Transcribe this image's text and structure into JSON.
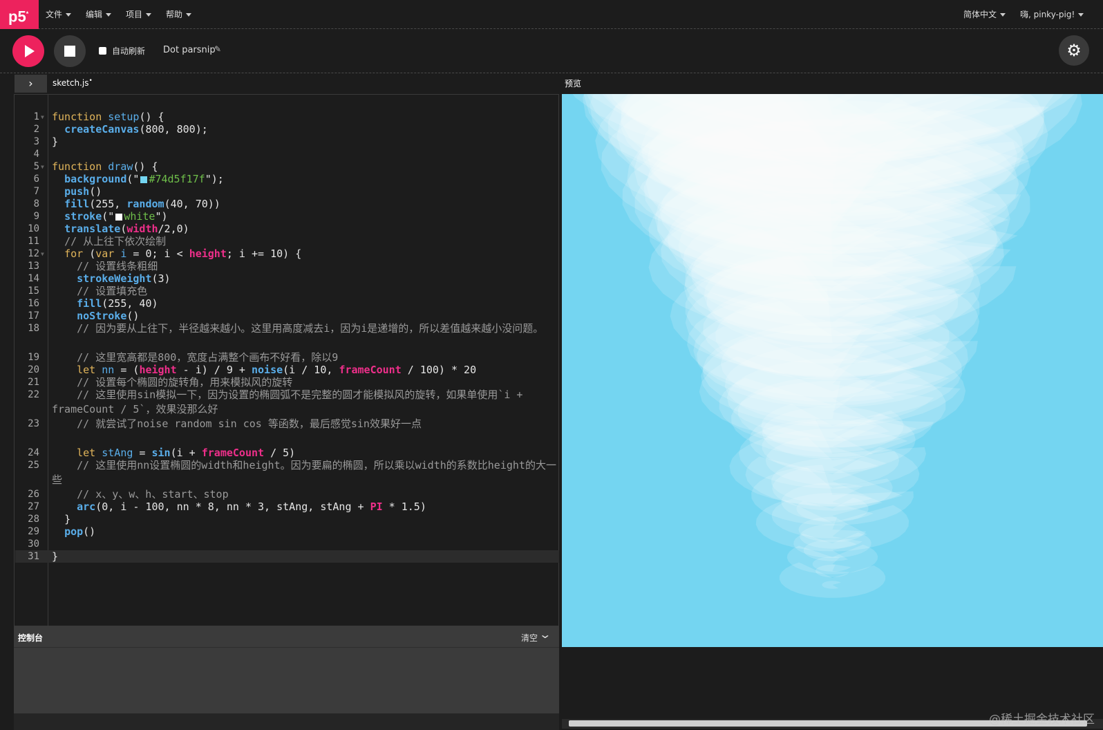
{
  "nav": {
    "logo": "p5",
    "logo_sup": "*",
    "menu": [
      "文件",
      "编辑",
      "项目",
      "帮助"
    ],
    "language": "简体中文",
    "user": "嗨, pinky-pig!"
  },
  "toolbar": {
    "auto_refresh": "自动刷新",
    "auto_refresh_checked": false,
    "project_name": "Dot parsnip"
  },
  "editor": {
    "file_tab": "sketch.js",
    "file_modified_mark": "•",
    "toggle_glyph": "›",
    "active_line": 31,
    "folds": [
      1,
      5,
      12
    ]
  },
  "code_lines": [
    {
      "n": "1",
      "segs": [
        [
          "kw",
          "function "
        ],
        [
          "dc",
          "setup"
        ],
        [
          "nm",
          "() {"
        ]
      ]
    },
    {
      "n": "2",
      "segs": [
        [
          "nm",
          "  "
        ],
        [
          "fn",
          "createCanvas"
        ],
        [
          "nm",
          "(800, 800);"
        ]
      ]
    },
    {
      "n": "3",
      "segs": [
        [
          "nm",
          "}"
        ]
      ]
    },
    {
      "n": "4",
      "segs": [
        [
          "nm",
          ""
        ]
      ]
    },
    {
      "n": "5",
      "segs": [
        [
          "kw",
          "function "
        ],
        [
          "dc",
          "draw"
        ],
        [
          "nm",
          "() {"
        ]
      ]
    },
    {
      "n": "6",
      "segs": [
        [
          "nm",
          "  "
        ],
        [
          "fn",
          "background"
        ],
        [
          "nm",
          "(\""
        ],
        [
          "sw",
          "#74d5f1"
        ],
        [
          "st",
          "#74d5f17f"
        ],
        [
          "nm",
          "\");"
        ]
      ]
    },
    {
      "n": "7",
      "segs": [
        [
          "nm",
          "  "
        ],
        [
          "fn",
          "push"
        ],
        [
          "nm",
          "()"
        ]
      ]
    },
    {
      "n": "8",
      "segs": [
        [
          "nm",
          "  "
        ],
        [
          "fn",
          "fill"
        ],
        [
          "nm",
          "(255, "
        ],
        [
          "fn",
          "random"
        ],
        [
          "nm",
          "(40, 70))"
        ]
      ]
    },
    {
      "n": "9",
      "segs": [
        [
          "nm",
          "  "
        ],
        [
          "fn",
          "stroke"
        ],
        [
          "nm",
          "(\""
        ],
        [
          "sw",
          "#ffffff"
        ],
        [
          "st",
          "white"
        ],
        [
          "nm",
          "\")"
        ]
      ]
    },
    {
      "n": "10",
      "segs": [
        [
          "nm",
          "  "
        ],
        [
          "fn",
          "translate"
        ],
        [
          "nm",
          "("
        ],
        [
          "vr",
          "width"
        ],
        [
          "nm",
          "/2,0)"
        ]
      ]
    },
    {
      "n": "11",
      "segs": [
        [
          "cm",
          "  // 从上往下依次绘制"
        ]
      ]
    },
    {
      "n": "12",
      "segs": [
        [
          "nm",
          "  "
        ],
        [
          "kw",
          "for "
        ],
        [
          "nm",
          "("
        ],
        [
          "kw",
          "var "
        ],
        [
          "dc",
          "i"
        ],
        [
          "nm",
          " = 0; i < "
        ],
        [
          "vr",
          "height"
        ],
        [
          "nm",
          "; i += 10) {"
        ]
      ]
    },
    {
      "n": "13",
      "segs": [
        [
          "cm",
          "    // 设置线条粗细"
        ]
      ]
    },
    {
      "n": "14",
      "segs": [
        [
          "nm",
          "    "
        ],
        [
          "fn",
          "strokeWeight"
        ],
        [
          "nm",
          "(3)"
        ]
      ]
    },
    {
      "n": "15",
      "segs": [
        [
          "cm",
          "    // 设置填充色"
        ]
      ]
    },
    {
      "n": "16",
      "segs": [
        [
          "nm",
          "    "
        ],
        [
          "fn",
          "fill"
        ],
        [
          "nm",
          "(255, 40)"
        ]
      ]
    },
    {
      "n": "17",
      "segs": [
        [
          "nm",
          "    "
        ],
        [
          "fn",
          "noStroke"
        ],
        [
          "nm",
          "()"
        ]
      ]
    },
    {
      "n": "18",
      "segs": [
        [
          "cm",
          "    // 因为要从上往下，半径越来越小。这里用高度减去i，因为i是递增的，所以差值越来越小没问题。"
        ]
      ]
    },
    {
      "n": "19",
      "segs": [
        [
          "cm",
          "    // 这里宽高都是800，宽度占满整个画布不好看，除以9"
        ]
      ]
    },
    {
      "n": "20",
      "segs": [
        [
          "nm",
          "    "
        ],
        [
          "kw",
          "let "
        ],
        [
          "dc",
          "nn"
        ],
        [
          "nm",
          " = ("
        ],
        [
          "vr",
          "height"
        ],
        [
          "nm",
          " - i) / 9 + "
        ],
        [
          "fn",
          "noise"
        ],
        [
          "nm",
          "(i / 10, "
        ],
        [
          "vr",
          "frameCount"
        ],
        [
          "nm",
          " / 100) * 20"
        ]
      ]
    },
    {
      "n": "21",
      "segs": [
        [
          "cm",
          "    // 设置每个椭圆的旋转角，用来模拟风的旋转"
        ]
      ]
    },
    {
      "n": "22",
      "segs": [
        [
          "cm",
          "    // 这里使用sin模拟一下，因为设置的椭圆弧不是完整的圆才能模拟风的旋转，如果单使用`i + frameCount / 5`，效果没那么好"
        ]
      ]
    },
    {
      "n": "23",
      "segs": [
        [
          "cm",
          "    // 就尝试了noise random sin cos 等函数，最后感觉sin效果好一点"
        ]
      ]
    },
    {
      "n": "24",
      "segs": [
        [
          "nm",
          "    "
        ],
        [
          "kw",
          "let "
        ],
        [
          "dc",
          "stAng"
        ],
        [
          "nm",
          " = "
        ],
        [
          "fn",
          "sin"
        ],
        [
          "nm",
          "(i + "
        ],
        [
          "vr",
          "frameCount"
        ],
        [
          "nm",
          " / 5)"
        ]
      ]
    },
    {
      "n": "25",
      "segs": [
        [
          "cm",
          "    // 这里使用nn设置椭圆的width和height。因为要扁的椭圆，所以乘以width的系数比height的大一些"
        ]
      ]
    },
    {
      "n": "26",
      "segs": [
        [
          "cm",
          "    // x、y、w、h、start、stop"
        ]
      ]
    },
    {
      "n": "27",
      "segs": [
        [
          "nm",
          "    "
        ],
        [
          "fn",
          "arc"
        ],
        [
          "nm",
          "(0, i - 100, nn * 8, nn * 3, stAng, stAng + "
        ],
        [
          "vr",
          "PI"
        ],
        [
          "nm",
          " * 1.5)"
        ]
      ]
    },
    {
      "n": "28",
      "segs": [
        [
          "nm",
          "  }"
        ]
      ]
    },
    {
      "n": "29",
      "segs": [
        [
          "nm",
          "  "
        ],
        [
          "fn",
          "pop"
        ],
        [
          "nm",
          "()"
        ]
      ]
    },
    {
      "n": "30",
      "segs": [
        [
          "nm",
          ""
        ]
      ]
    },
    {
      "n": "31",
      "segs": [
        [
          "nm",
          "}"
        ]
      ]
    }
  ],
  "console": {
    "title": "控制台",
    "clear": "清空"
  },
  "preview": {
    "label": "预览",
    "background": "#74d5f1"
  },
  "watermark": "@稀土掘金技术社区",
  "colors": {
    "accent": "#ed225d",
    "keyword": "#e0b45a",
    "function": "#5aaeea",
    "variable": "#ee2f8a",
    "string": "#6fbf4a",
    "comment": "#9a9a9a"
  }
}
